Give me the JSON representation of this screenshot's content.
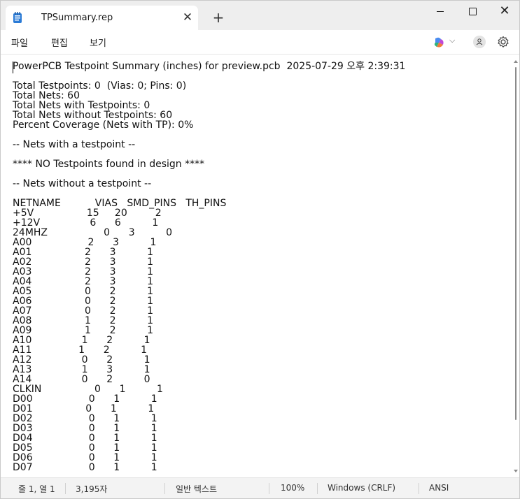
{
  "tab": {
    "title": "TPSummary.rep",
    "close_glyph": "✕"
  },
  "new_tab_glyph": "+",
  "window_controls": {
    "close_glyph": "✕"
  },
  "menu": {
    "file": "파일",
    "edit": "편집",
    "view": "보기",
    "chevron": "⌵"
  },
  "document": {
    "lines": [
      "PowerPCB Testpoint Summary (inches) for preview.pcb  2025-07-29 오후 2:39:31",
      "",
      "Total Testpoints: 0  (Vias: 0; Pins: 0)",
      "Total Nets: 60",
      "Total Nets with Testpoints: 0",
      "Total Nets without Testpoints: 60",
      "Percent Coverage (Nets with TP): 0%",
      "",
      "-- Nets with a testpoint --",
      "",
      "**** NO Testpoints found in design ****",
      "",
      "-- Nets without a testpoint --",
      "",
      "NETNAME           VIAS   SMD_PINS   TH_PINS",
      "+5V                 15     20         2",
      "+12V                6      6          1",
      "24MHZ                  0      3          0",
      "A00                  2      3          1",
      "A01                 2      3          1",
      "A02                 2      3          1",
      "A03                 2      3          1",
      "A04                 2      3          1",
      "A05                 0      2          1",
      "A06                 0      2          1",
      "A07                 0      2          1",
      "A08                 1      2          1",
      "A09                 1      2          1",
      "A10                1      2          1",
      "A11               1      2          1",
      "A12                0      2          1",
      "A13                1      3          1",
      "A14                0      2          0",
      "CLKIN                 0      1          1",
      "D00                  0      1          1",
      "D01                 0      1          1",
      "D02                  0      1          1",
      "D03                  0      1          1",
      "D04                  0      1          1",
      "D05                  0      1          1",
      "D06                  0      1          1",
      "D07                  0      1          1"
    ]
  },
  "status": {
    "position": "줄 1, 열 1",
    "char_count": "3,195자",
    "format": "일반 텍스트",
    "zoom": "100%",
    "line_ending": "Windows (CRLF)",
    "encoding": "ANSI"
  }
}
